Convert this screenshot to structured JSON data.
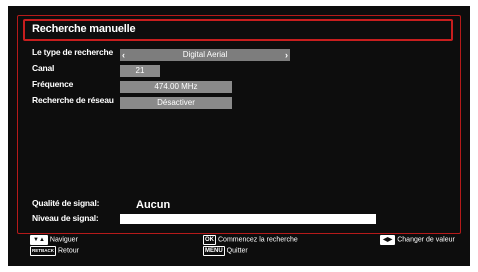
{
  "window": {
    "title": "Recherche manuelle"
  },
  "settings": [
    {
      "label": "Le type de recherche",
      "value": "Digital Aerial",
      "prev_glyph": "‹",
      "next_glyph": "›"
    },
    {
      "label": "Canal",
      "value": "21"
    },
    {
      "label": "Fréquence",
      "value": "474.00 MHz"
    },
    {
      "label": "Recherche de réseau",
      "value": "Désactiver"
    }
  ],
  "signal": {
    "quality_label": "Qualité de signal:",
    "quality_value": "Aucun",
    "level_label": "Niveau de signal:",
    "level_fraction": 0
  },
  "footer": {
    "navigate_key": "▼▲",
    "navigate_label": "Naviguer",
    "back_key": "RETBACK",
    "back_label": "Retour",
    "ok_key": "OK",
    "ok_label": "Commencez la recherche",
    "menu_key": "MENU",
    "menu_label": "Quitter",
    "value_key": "◀▶",
    "value_label": "Changer de valeur"
  },
  "colors": {
    "background": "#0d0d0d",
    "accent_border": "#c81e1e",
    "field_bg": "#8a8a8a",
    "text": "#ffffff"
  }
}
